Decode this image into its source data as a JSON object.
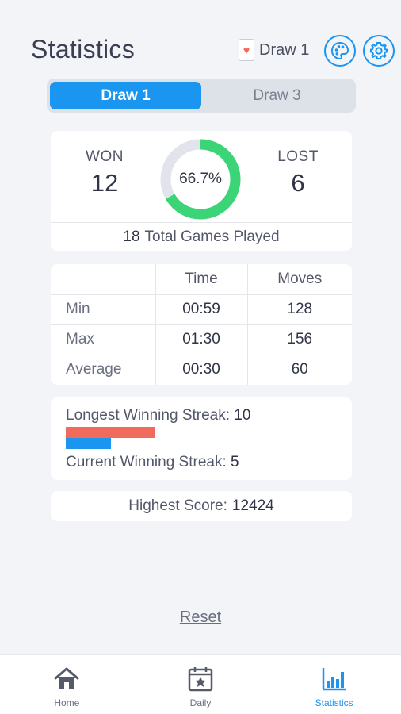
{
  "header": {
    "title": "Statistics",
    "draw_mode_label": "Draw 1",
    "card_suit": "♥"
  },
  "segmented": {
    "options": [
      "Draw 1",
      "Draw 3"
    ],
    "selected": "Draw 1"
  },
  "results": {
    "won_label": "WON",
    "won_value": "12",
    "lost_label": "LOST",
    "lost_value": "6",
    "win_percent_text": "66.7%",
    "win_fraction": 0.667,
    "total_games_value": "18",
    "total_games_label": "Total Games Played"
  },
  "table": {
    "headers": [
      "",
      "Time",
      "Moves"
    ],
    "rows": [
      {
        "label": "Min",
        "time": "00:59",
        "moves": "128"
      },
      {
        "label": "Max",
        "time": "01:30",
        "moves": "156"
      },
      {
        "label": "Average",
        "time": "00:30",
        "moves": "60"
      }
    ]
  },
  "streaks": {
    "longest_label": "Longest Winning Streak:",
    "longest_value": "10",
    "current_label": "Current Winning Streak:",
    "current_value": "5"
  },
  "score": {
    "label": "Highest Score:",
    "value": "12424"
  },
  "reset_label": "Reset",
  "tabs": [
    {
      "label": "Home",
      "icon": "home-icon",
      "active": false
    },
    {
      "label": "Daily",
      "icon": "calendar-star-icon",
      "active": false
    },
    {
      "label": "Statistics",
      "icon": "bar-chart-icon",
      "active": true
    }
  ],
  "colors": {
    "accent": "#1a96f0",
    "won_ring": "#3bd476",
    "ring_track": "#e1e4ea",
    "longest_bar": "#f06b5c",
    "current_bar": "#1a96f0"
  }
}
